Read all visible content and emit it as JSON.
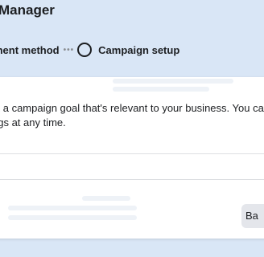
{
  "header": {
    "title": "Manager"
  },
  "steps": {
    "previous_label": "ment method",
    "current_label": "Campaign setup"
  },
  "card": {
    "description_line1": "st a campaign goal that's relevant to your business. You can",
    "description_line2": "ngs at any time."
  },
  "footer": {
    "back_label": "Ba"
  }
}
